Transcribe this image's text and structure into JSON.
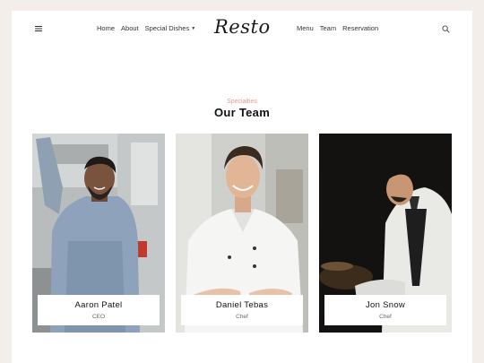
{
  "header": {
    "logo": "Resto",
    "nav_left": [
      {
        "label": "Home"
      },
      {
        "label": "About"
      },
      {
        "label": "Special Dishes"
      }
    ],
    "nav_right": [
      {
        "label": "Menu"
      },
      {
        "label": "Team"
      },
      {
        "label": "Reservation"
      }
    ],
    "icons": {
      "menu": "hamburger-icon",
      "search": "search-icon"
    }
  },
  "section": {
    "kicker": "Specialties",
    "title": "Our Team"
  },
  "team": [
    {
      "name": "Aaron Patel",
      "role": "CEO"
    },
    {
      "name": "Daniel Tebas",
      "role": "Chef"
    },
    {
      "name": "Jon Snow",
      "role": "Chef"
    }
  ],
  "colors": {
    "background": "#f4eeea",
    "accent": "#e59b8e",
    "text": "#111111"
  }
}
